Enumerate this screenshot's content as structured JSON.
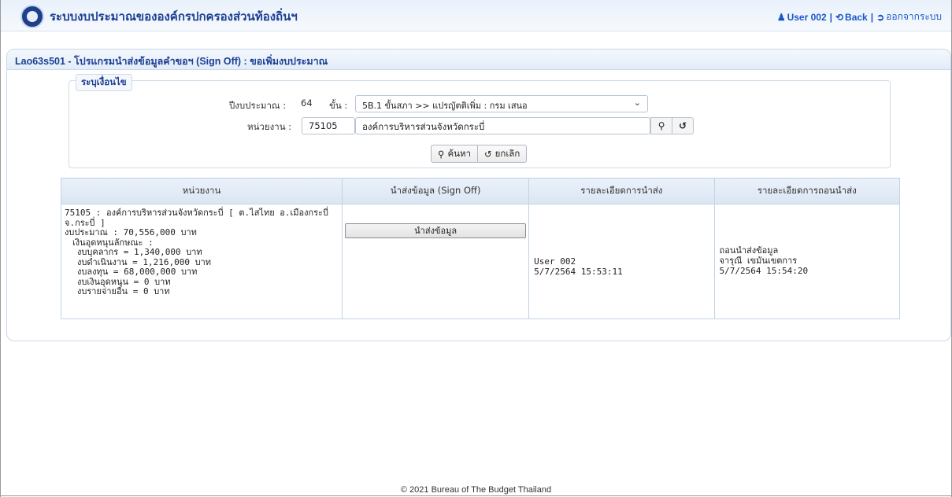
{
  "header": {
    "app_title": "ระบบงบประมาณขององค์กรปกครองส่วนท้องถิ่นฯ",
    "user_label": "User 002",
    "back_label": "Back",
    "logout_label": "ออกจากระบบ",
    "separator": "|"
  },
  "page": {
    "title": "Lao63s501 - โปรแกรมนำส่งข้อมูลคำขอฯ (Sign Off) : ขอเพิ่มงบประมาณ"
  },
  "filter": {
    "legend": "ระบุเงื่อนไข",
    "year_label": "ปีงบประมาณ :",
    "year_value": "64",
    "stage_label": "ขั้น :",
    "stage_selected": "5B.1 ขั้นสภา >> แปรญัตติเพิ่ม : กรม เสนอ",
    "unit_label": "หน่วยงาน :",
    "unit_code": "75105",
    "unit_name": "องค์การบริหารส่วนจังหวัดกระบี่",
    "search_label": "ค้นหา",
    "cancel_label": "ยกเลิก"
  },
  "table": {
    "headers": [
      "หน่วยงาน",
      "นำส่งข้อมูล (Sign Off)",
      "รายละเอียดการนำส่ง",
      "รายละเอียดการถอนนำส่ง"
    ],
    "row": {
      "unit_line1": "75105 : องค์การบริหารส่วนจังหวัดกระบี่ [ ต.ไสไทย อ.เมืองกระบี่",
      "unit_line2": "จ.กระบี่ ]",
      "budget_total": "งบประมาณ : 70,556,000 บาท",
      "subsidy_title": "เงินอุดหนุนลักษณะ :",
      "items": [
        "งบบุคลากร = 1,340,000 บาท",
        "งบดำเนินงาน = 1,216,000 บาท",
        "งบลงทุน = 68,000,000 บาท",
        "งบเงินอุดหนุน = 0 บาท",
        "งบรายจ่ายอื่น = 0 บาท"
      ],
      "sign_off_button": "นำส่งข้อมูล",
      "submit_user": "User 002",
      "submit_time": "5/7/2564 15:53:11",
      "withdraw_title": "ถอนนำส่งข้อมูล",
      "withdraw_user": "จารุณี เขมันเขตการ",
      "withdraw_time": "5/7/2564 15:54:20"
    }
  },
  "footer": {
    "copyright": "© 2021 Bureau of The Budget Thailand"
  }
}
